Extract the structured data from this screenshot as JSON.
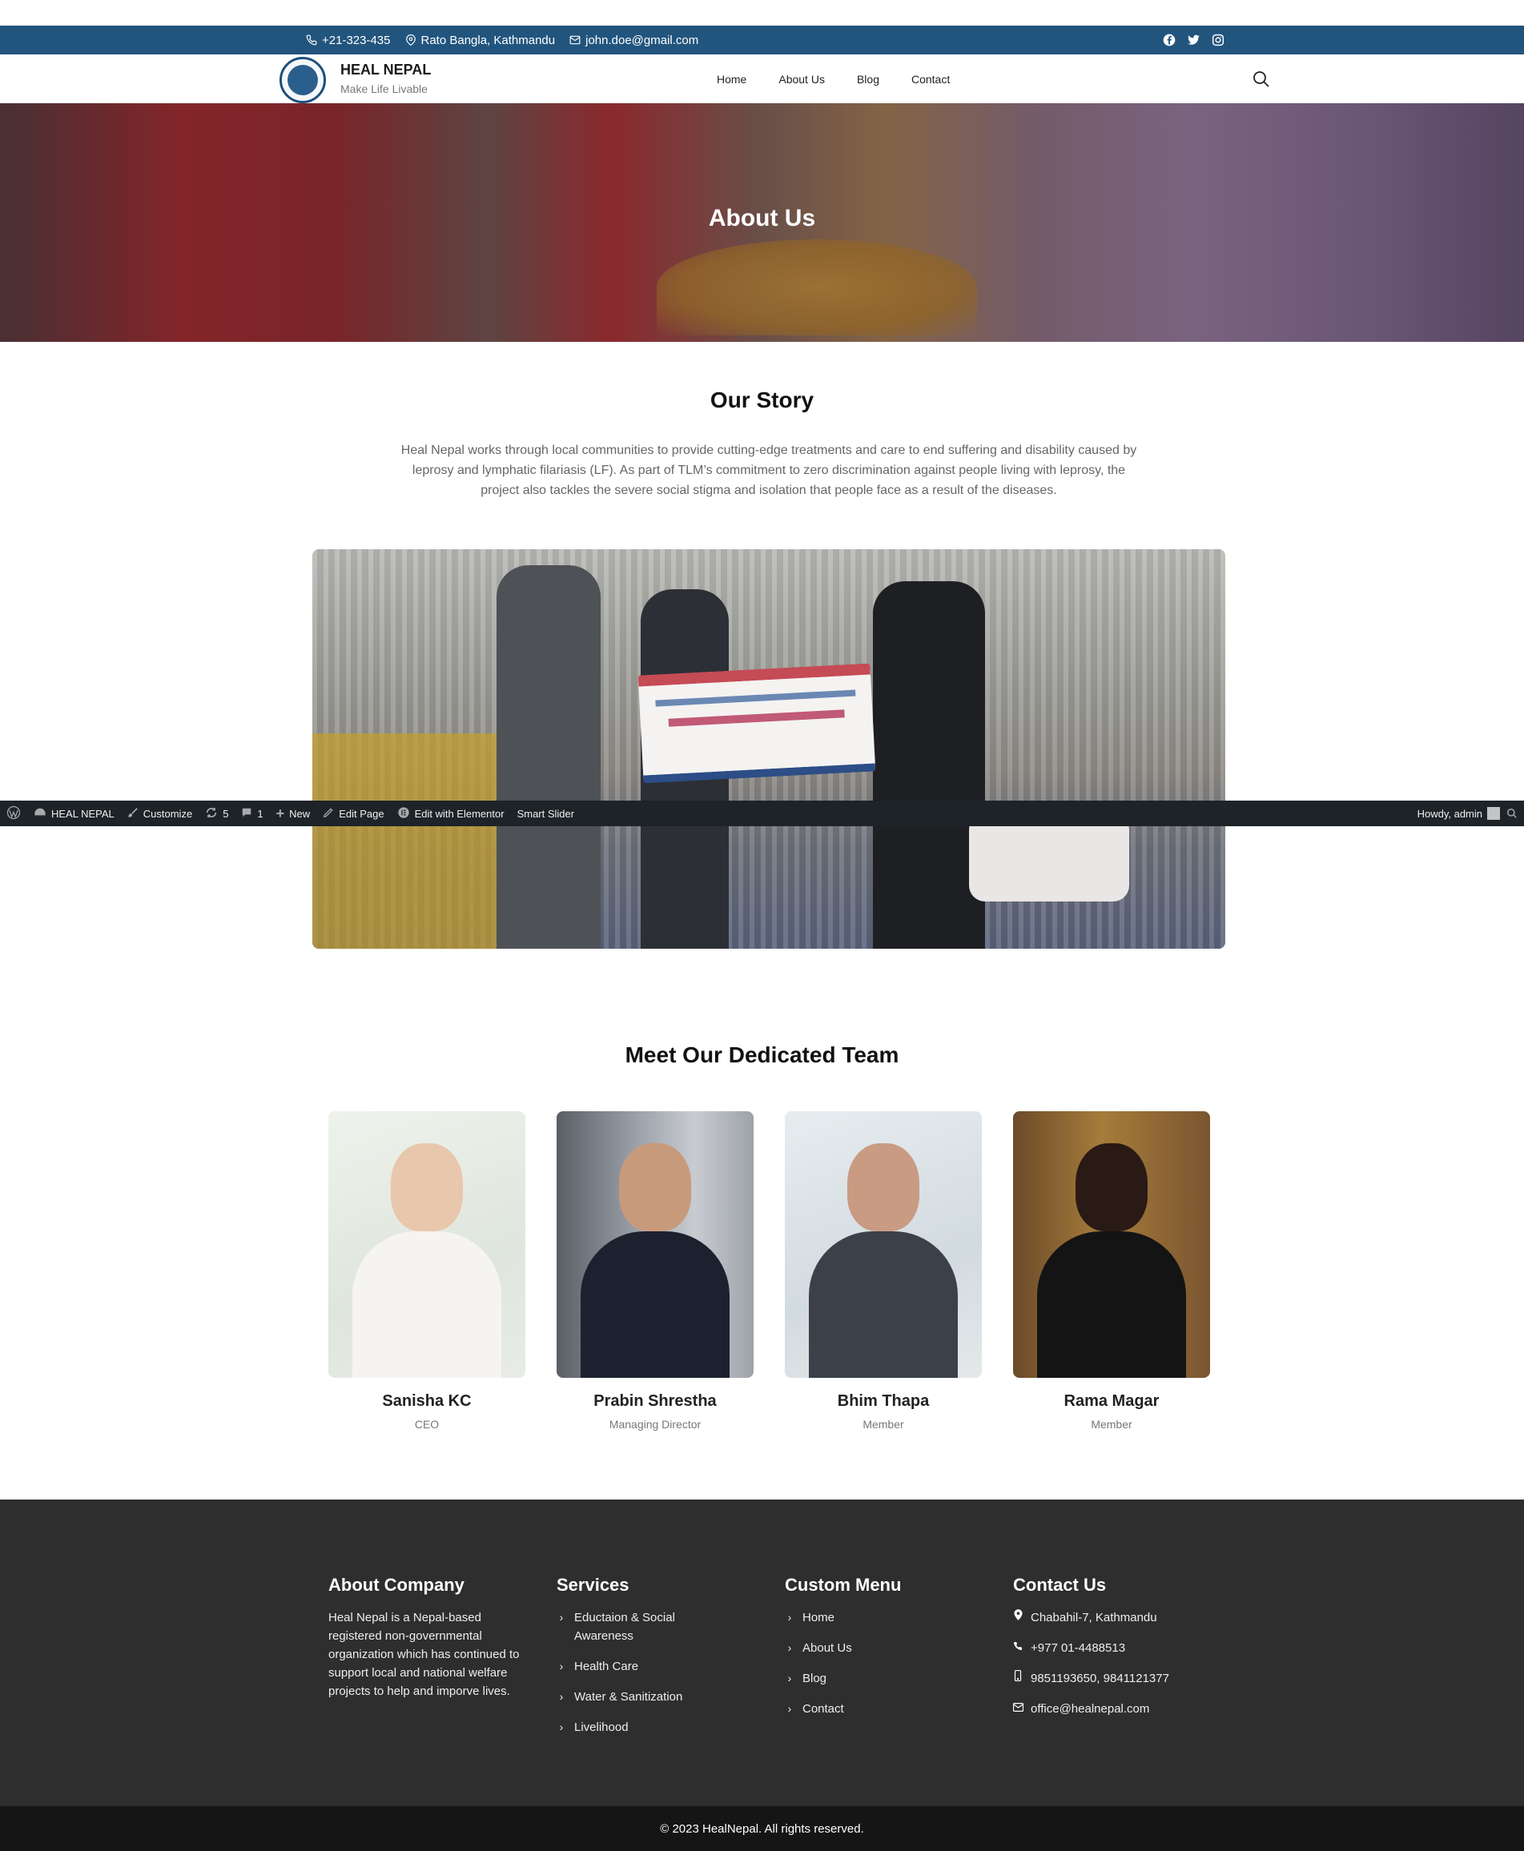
{
  "topbar": {
    "phone": "+21-323-435",
    "address": "Rato Bangla, Kathmandu",
    "email": "john.doe@gmail.com",
    "socials": [
      "facebook-icon",
      "twitter-icon",
      "instagram-icon"
    ],
    "background_color": "#22557e"
  },
  "header": {
    "brand_title": "HEAL NEPAL",
    "brand_tagline": "Make Life Livable",
    "nav": [
      "Home",
      "About Us",
      "Blog",
      "Contact"
    ]
  },
  "hero": {
    "title": "About Us"
  },
  "story": {
    "title": "Our Story",
    "text": "Heal Nepal  works through local communities to provide cutting-edge treatments and care to end suffering and disability caused by leprosy and lymphatic filariasis (LF). As part of TLM’s commitment to zero discrimination against people living with leprosy, the project also tackles the severe social stigma and isolation that people face as a result of the diseases."
  },
  "adminbar": {
    "items": [
      "HEAL NEPAL",
      "Customize",
      "5",
      "1",
      "New",
      "Edit Page",
      "Edit with Elementor",
      "Smart Slider"
    ],
    "greeting": "Howdy, admin",
    "background_color": "#1d2327"
  },
  "team": {
    "title": "Meet Our Dedicated Team",
    "members": [
      {
        "name": "Sanisha KC",
        "role": "CEO"
      },
      {
        "name": "Prabin Shrestha",
        "role": "Managing Director"
      },
      {
        "name": "Bhim Thapa",
        "role": "Member"
      },
      {
        "name": "Rama Magar",
        "role": "Member"
      }
    ]
  },
  "footer": {
    "about": {
      "title": "About Company",
      "text": "Heal Nepal is a Nepal-based registered non-governmental organization which has continued to support local and national welfare projects to help and imporve lives."
    },
    "services": {
      "title": "Services",
      "items": [
        "Eductaion & Social Awareness",
        "Health Care",
        "Water & Sanitization",
        "Livelihood"
      ]
    },
    "menu": {
      "title": "Custom Menu",
      "items": [
        "Home",
        "About Us",
        "Blog",
        "Contact"
      ]
    },
    "contact": {
      "title": "Contact Us",
      "items": [
        {
          "icon": "location-pin-icon",
          "text": "Chabahil-7, Kathmandu"
        },
        {
          "icon": "phone-icon",
          "text": "+977 01-4488513"
        },
        {
          "icon": "mobile-icon",
          "text": "9851193650, 9841121377"
        },
        {
          "icon": "envelope-icon",
          "text": "office@healnepal.com"
        }
      ]
    },
    "background_color": "#2e2e2e"
  },
  "copyright": "© 2023 HealNepal. All rights reserved."
}
